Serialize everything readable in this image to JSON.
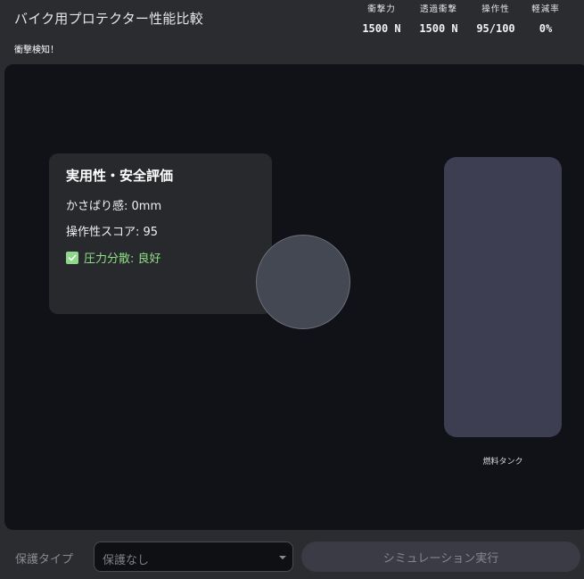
{
  "header": {
    "title": "バイク用プロテクター性能比較",
    "alert": "衝撃検知！"
  },
  "metrics": [
    {
      "label": "衝撃力",
      "value": "1500 N"
    },
    {
      "label": "透過衝撃",
      "value": "1500 N"
    },
    {
      "label": "操作性",
      "value": "95/100"
    },
    {
      "label": "軽減率",
      "value": "0%"
    }
  ],
  "card": {
    "title": "実用性・安全評価",
    "bulk": "かさばり感: 0mm",
    "operability_score": "操作性スコア: 95",
    "pressure_status": "圧力分散: 良好"
  },
  "tank": {
    "label": "燃料タンク"
  },
  "controls": {
    "type_label": "保護タイプ",
    "protection_selected": "保護なし",
    "run_button": "シミュレーション実行"
  },
  "colors": {
    "stage_bg": "#111217",
    "card_bg": "#28292d",
    "status_green": "#8fdf86",
    "tank_fill": "#3e3e52",
    "impactor_fill": "#434852"
  }
}
